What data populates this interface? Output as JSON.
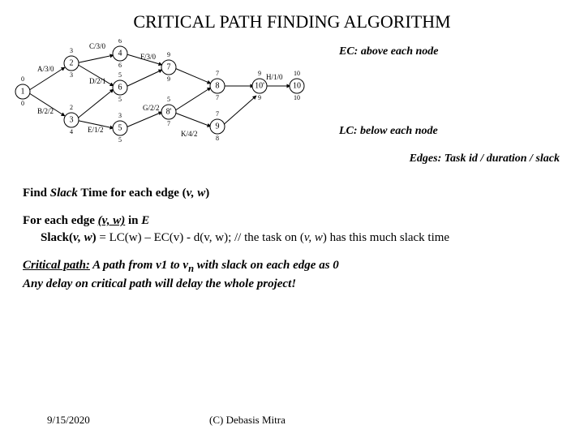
{
  "title": "CRITICAL PATH FINDING ALGORITHM",
  "notes": {
    "ec": "EC: above each node",
    "lc": "LC: below each node",
    "edges": "Edges: Task id / duration / slack"
  },
  "graph": {
    "nodes": [
      {
        "id": "1",
        "above": "0",
        "below": "0"
      },
      {
        "id": "2",
        "above": "3",
        "below": "3"
      },
      {
        "id": "3",
        "above": "2",
        "below": "4"
      },
      {
        "id": "4",
        "above": "6",
        "below": "6"
      },
      {
        "id": "5",
        "above": "3",
        "below": "5"
      },
      {
        "id": "6",
        "above": "5",
        "below": "5"
      },
      {
        "id": "7",
        "above": "9",
        "below": "9"
      },
      {
        "id": "8'",
        "above": "5",
        "below": "7"
      },
      {
        "id": "8",
        "above": "7",
        "below": "7"
      },
      {
        "id": "9",
        "above": "7",
        "below": "8"
      },
      {
        "id": "10'",
        "above": "9",
        "below": "9"
      },
      {
        "id": "10",
        "above": "10",
        "below": "10"
      }
    ],
    "edges": [
      {
        "task": "A",
        "dur": 3,
        "slack": 0
      },
      {
        "task": "B",
        "dur": 2,
        "slack": 2
      },
      {
        "task": "C",
        "dur": 3,
        "slack": 0
      },
      {
        "task": "D",
        "dur": 2,
        "slack": 1
      },
      {
        "task": "E",
        "dur": 1,
        "slack": 2
      },
      {
        "task": "F",
        "dur": 3,
        "slack": 0
      },
      {
        "task": "G",
        "dur": 2,
        "slack": 2
      },
      {
        "task": "H",
        "dur": 1,
        "slack": 0
      },
      {
        "task": "K",
        "dur": 4,
        "slack": 2
      }
    ]
  },
  "heading1": {
    "pre": "Find ",
    "mid": "Slack",
    "post": " Time for each edge (",
    "vw": "v, w",
    "close": ")"
  },
  "algo": {
    "line1a": "For each edge ",
    "line1b": "(v, w)",
    "line1c": " in ",
    "line1d": "E",
    "line2a": "Slack(",
    "line2b": "v, w",
    "line2c": ") ",
    "line2d": " = LC(w) – EC(v) - d(v, w);   // the task on (",
    "line2e": "v, w",
    "line2f": ") has this much slack time"
  },
  "cp": {
    "line1a": "Critical path:",
    "line1b": " A path from ",
    "line1c": "v1",
    "line1d": " to ",
    "line1e": "v",
    "line1en": "n",
    "line1f": " with slack on each edge as 0",
    "line2": "Any delay on critical path will delay the whole project!"
  },
  "footer": {
    "date": "9/15/2020",
    "copy": "(C) Debasis Mitra"
  }
}
